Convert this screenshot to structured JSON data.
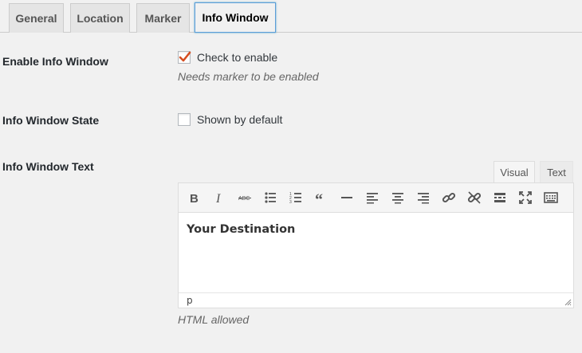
{
  "tabs": [
    {
      "label": "General",
      "active": false
    },
    {
      "label": "Location",
      "active": false
    },
    {
      "label": "Marker",
      "active": false
    },
    {
      "label": "Info Window",
      "active": true
    }
  ],
  "fields": {
    "enable": {
      "label": "Enable Info Window",
      "checkbox_label": "Check to enable",
      "checked": true,
      "description": "Needs marker to be enabled"
    },
    "state": {
      "label": "Info Window State",
      "checkbox_label": "Shown by default",
      "checked": false
    },
    "text": {
      "label": "Info Window Text",
      "description": "HTML allowed"
    }
  },
  "editor": {
    "tabs": {
      "visual": "Visual",
      "text": "Text"
    },
    "toolbar": [
      "bold-icon",
      "italic-icon",
      "strikethrough-icon",
      "bullet-list-icon",
      "numbered-list-icon",
      "blockquote-icon",
      "horizontal-line-icon",
      "align-left-icon",
      "align-center-icon",
      "align-right-icon",
      "link-icon",
      "unlink-icon",
      "read-more-icon",
      "fullscreen-icon",
      "toolbar-toggle-icon"
    ],
    "content": "Your Destination",
    "path": "p"
  },
  "colors": {
    "accent": "#5b9dd9",
    "check": "#d54e21"
  }
}
